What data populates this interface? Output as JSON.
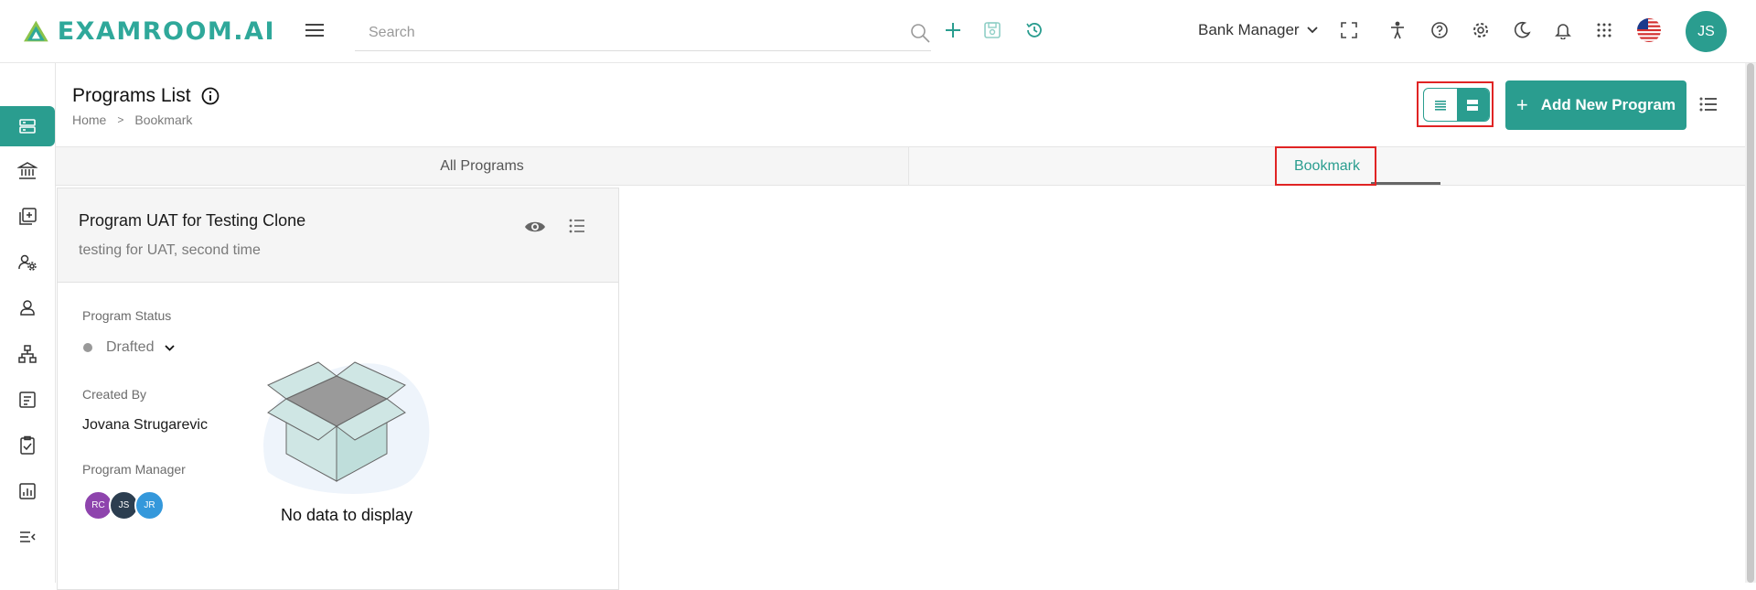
{
  "header": {
    "logo_text": "EXAMROOM.AI",
    "search_placeholder": "Search",
    "role": "Bank Manager",
    "user_initials": "JS",
    "icons": [
      "search-icon",
      "plus-icon",
      "save-icon",
      "history-icon",
      "fullscreen-icon",
      "accessibility-icon",
      "help-icon",
      "settings-icon",
      "dark-mode-icon",
      "bell-icon",
      "apps-grid-icon",
      "us-flag-icon"
    ]
  },
  "sidebar": {
    "items": [
      "programs-icon",
      "bank-icon",
      "add-library-icon",
      "user-settings-icon",
      "user-icon",
      "hierarchy-icon",
      "forms-icon",
      "checklist-icon",
      "reports-icon",
      "collapse-menu-icon"
    ],
    "active_index": 0
  },
  "page": {
    "title": "Programs List",
    "breadcrumb": [
      "Home",
      "Bookmark"
    ],
    "breadcrumb_separator": ">",
    "add_button": "Add New Program",
    "add_button_plus": "+"
  },
  "tabs": [
    {
      "label": "All Programs",
      "active": false
    },
    {
      "label": "Bookmark",
      "active": true
    }
  ],
  "card": {
    "title": "Program UAT for Testing Clone",
    "subtitle": "testing for UAT, second time",
    "status_label": "Program Status",
    "status_value": "Drafted",
    "created_by_label": "Created By",
    "created_by": "Jovana Strugarevic",
    "manager_label": "Program Manager",
    "managers": [
      {
        "initials": "RC",
        "color": "#8e44ad"
      },
      {
        "initials": "JS",
        "color": "#2c3e50"
      },
      {
        "initials": "JR",
        "color": "#3498db"
      }
    ],
    "empty_text": "No data to display"
  },
  "colors": {
    "accent": "#2a9d8f",
    "highlight_outline": "#e02424"
  }
}
